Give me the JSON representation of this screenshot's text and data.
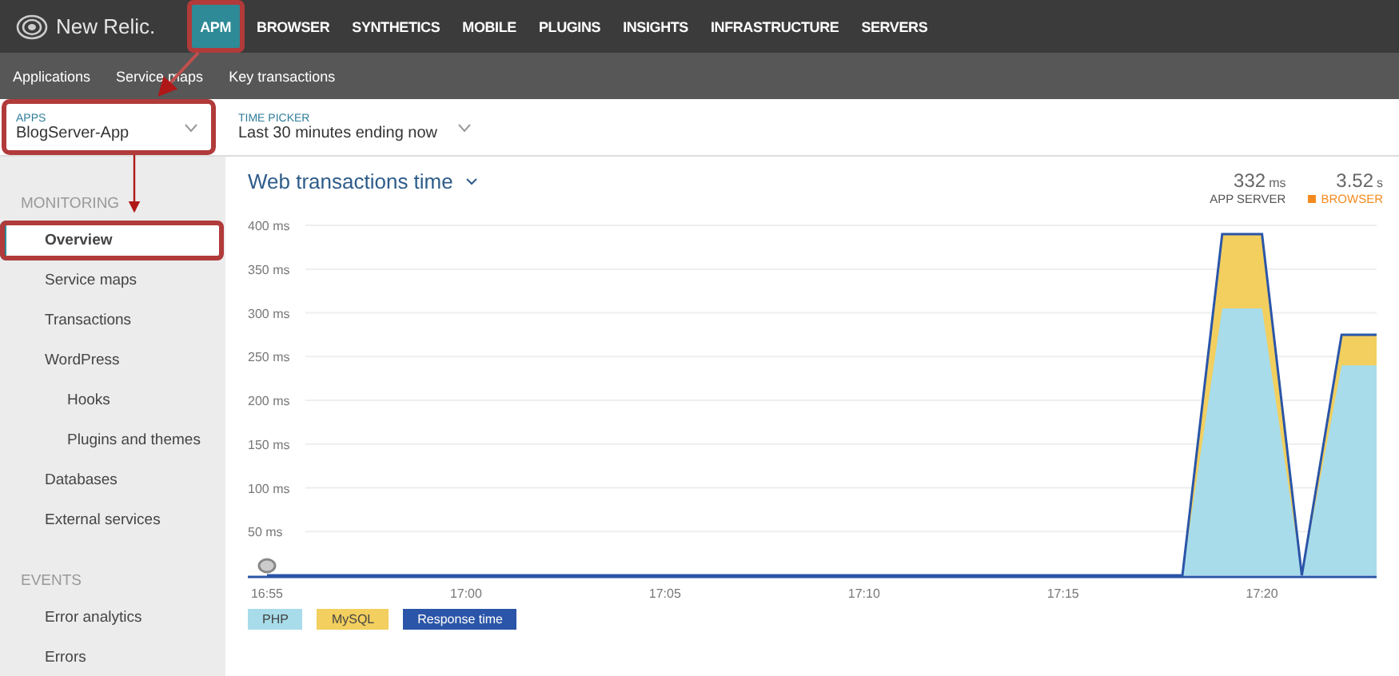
{
  "brand": {
    "name": "New Relic."
  },
  "top_nav": [
    {
      "label": "APM",
      "selected": true,
      "highlighted": true
    },
    {
      "label": "BROWSER",
      "selected": false,
      "highlighted": false
    },
    {
      "label": "SYNTHETICS",
      "selected": false,
      "highlighted": false
    },
    {
      "label": "MOBILE",
      "selected": false,
      "highlighted": false
    },
    {
      "label": "PLUGINS",
      "selected": false,
      "highlighted": false
    },
    {
      "label": "INSIGHTS",
      "selected": false,
      "highlighted": false
    },
    {
      "label": "INFRASTRUCTURE",
      "selected": false,
      "highlighted": false
    },
    {
      "label": "SERVERS",
      "selected": false,
      "highlighted": false
    }
  ],
  "sub_nav": [
    "Applications",
    "Service maps",
    "Key transactions"
  ],
  "apps_picker": {
    "label": "APPS",
    "value": "BlogServer-App",
    "highlighted": true
  },
  "time_picker": {
    "label": "TIME PICKER",
    "value": "Last 30 minutes ending now"
  },
  "sidebar": {
    "sections": [
      {
        "title": "MONITORING",
        "items": [
          {
            "label": "Overview",
            "selected": true,
            "highlighted": true
          },
          {
            "label": "Service maps",
            "selected": false,
            "highlighted": false
          },
          {
            "label": "Transactions",
            "selected": false,
            "highlighted": false
          },
          {
            "label": "WordPress",
            "selected": false,
            "highlighted": false,
            "children": [
              {
                "label": "Hooks",
                "selected": false,
                "highlighted": false
              },
              {
                "label": "Plugins and themes",
                "selected": false,
                "highlighted": false
              }
            ]
          },
          {
            "label": "Databases",
            "selected": false,
            "highlighted": false
          },
          {
            "label": "External services",
            "selected": false,
            "highlighted": false
          }
        ]
      },
      {
        "title": "EVENTS",
        "items": [
          {
            "label": "Error analytics",
            "selected": false,
            "highlighted": false
          },
          {
            "label": "Errors",
            "selected": false,
            "highlighted": false
          }
        ]
      }
    ]
  },
  "chart_panel": {
    "title": "Web transactions time",
    "line_legend": {
      "label": "Response time",
      "color": "#2a55a8"
    },
    "stats": [
      {
        "value": "332",
        "unit": "ms",
        "label": "APP SERVER",
        "color": "#555555"
      },
      {
        "value": "3.52",
        "unit": "s",
        "label": "BROWSER",
        "color": "#f58b1f"
      }
    ],
    "chart_data": {
      "type": "area",
      "stacked": false,
      "categories": [
        "16:55",
        null,
        null,
        null,
        null,
        "17:00",
        null,
        null,
        null,
        null,
        "17:05",
        null,
        null,
        null,
        null,
        "17:10",
        null,
        null,
        null,
        null,
        "17:15",
        null,
        null,
        null,
        null,
        "17:20",
        null,
        null,
        null
      ],
      "series": [
        {
          "name": "PHP",
          "color": "#a8dcea",
          "values": [
            0,
            0,
            0,
            0,
            0,
            0,
            0,
            0,
            0,
            0,
            0,
            0,
            0,
            0,
            0,
            0,
            0,
            0,
            0,
            0,
            0,
            0,
            0,
            0,
            305,
            305,
            0,
            240,
            240
          ]
        },
        {
          "name": "MySQL",
          "color": "#f2cf5e",
          "values": [
            0,
            0,
            0,
            0,
            0,
            0,
            0,
            0,
            0,
            0,
            0,
            0,
            0,
            0,
            0,
            0,
            0,
            0,
            0,
            0,
            0,
            0,
            0,
            0,
            390,
            390,
            0,
            275,
            275
          ]
        }
      ],
      "grid": true,
      "ylim": [
        0,
        400
      ],
      "yticks": [
        {
          "value": 50,
          "label": "50 ms"
        },
        {
          "value": 100,
          "label": "100 ms"
        },
        {
          "value": 150,
          "label": "150 ms"
        },
        {
          "value": 200,
          "label": "200 ms"
        },
        {
          "value": 250,
          "label": "250 ms"
        },
        {
          "value": 300,
          "label": "300 ms"
        },
        {
          "value": 350,
          "label": "350 ms"
        },
        {
          "value": 400,
          "label": "400 ms"
        }
      ]
    }
  }
}
